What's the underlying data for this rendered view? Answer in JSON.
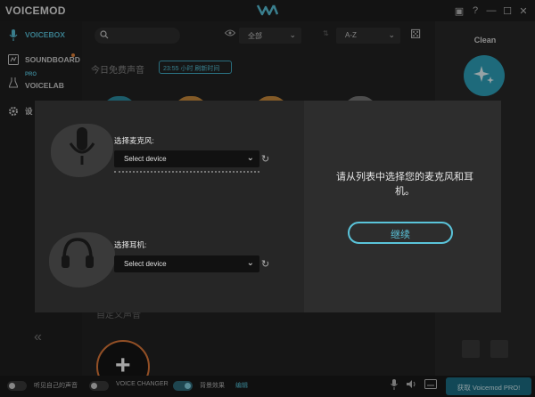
{
  "app": {
    "title": "VOICEMOD"
  },
  "sidebar": {
    "items": [
      {
        "label": "VOICEBOX",
        "icon": "microphone-icon"
      },
      {
        "label": "SOUNDBOARD",
        "icon": "soundboard-icon"
      },
      {
        "pro_tag": "PRO",
        "label": "VOICELAB",
        "icon": "flask-icon"
      },
      {
        "label": "设",
        "icon": "gear-icon"
      }
    ],
    "collapse": "«"
  },
  "toolbar": {
    "filter_value": "全部",
    "sort_value": "A-Z"
  },
  "main": {
    "free_voices_title": "今日免费声音",
    "timer_badge": "23:55 小时 刷新时间",
    "custom_section_title": "自定义声音",
    "add_symbol": "+"
  },
  "right_panel": {
    "voice_label": "Clean"
  },
  "bottom_bar": {
    "hear_myself": "听见自己的声音",
    "voice_changer": "VOICE CHANGER",
    "background_effects": "背景效果",
    "edit_link": "编辑",
    "get_pro": "获取 Voicemod PRO!"
  },
  "dialog": {
    "mic_label": "选择麦克风:",
    "mic_select": "Select device",
    "headphone_label": "选择耳机:",
    "headphone_select": "Select device",
    "message": "请从列表中选择您的麦克风和耳机。",
    "continue": "继续"
  },
  "colors": {
    "accent": "#58c0d8",
    "orange": "#e07a3a",
    "background": "#1a1a1a"
  }
}
